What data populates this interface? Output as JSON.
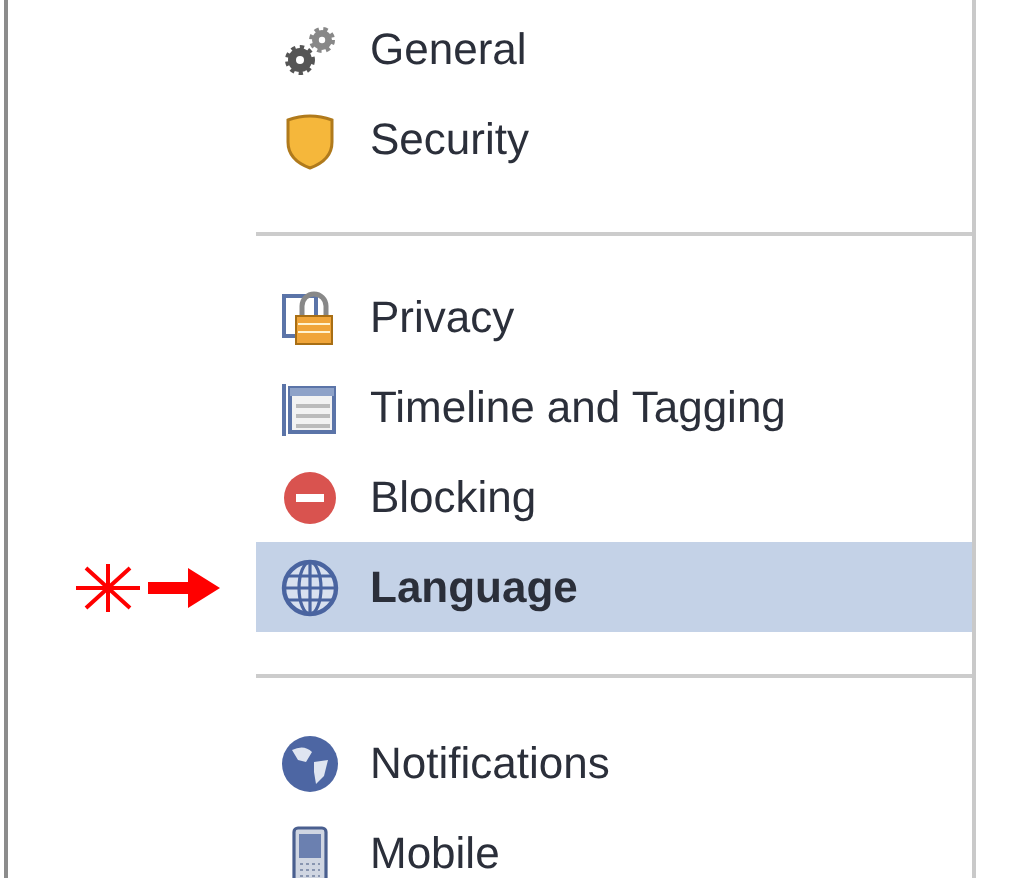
{
  "sections": [
    {
      "items": [
        {
          "label": "General",
          "selected": false
        },
        {
          "label": "Security",
          "selected": false
        }
      ]
    },
    {
      "items": [
        {
          "label": "Privacy",
          "selected": false
        },
        {
          "label": "Timeline and Tagging",
          "selected": false
        },
        {
          "label": "Blocking",
          "selected": false
        },
        {
          "label": "Language",
          "selected": true
        }
      ]
    },
    {
      "items": [
        {
          "label": "Notifications",
          "selected": false
        },
        {
          "label": "Mobile",
          "selected": false
        }
      ]
    }
  ]
}
